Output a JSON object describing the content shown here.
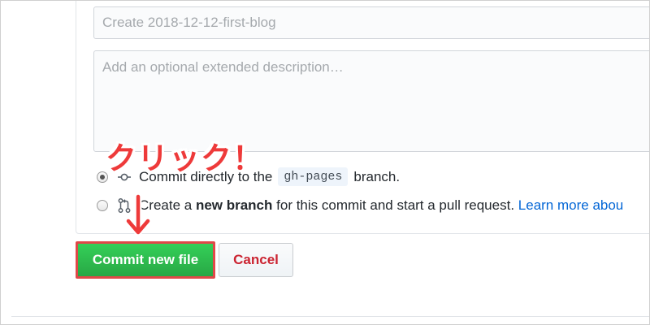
{
  "commit_form": {
    "summary_placeholder": "Create 2018-12-12-first-blog",
    "description_placeholder": "Add an optional extended description…",
    "option_direct": {
      "prefix": "Commit directly to the",
      "branch": "gh-pages",
      "suffix": "branch.",
      "selected": true
    },
    "option_new_branch": {
      "prefix": "Create a",
      "bold": "new branch",
      "middle": "for this commit and start a pull request.",
      "link": "Learn more abou",
      "selected": false
    },
    "commit_button_label": "Commit new file",
    "cancel_button_label": "Cancel"
  },
  "annotation": {
    "text": "クリック！",
    "color": "#ee3a3a"
  },
  "colors": {
    "commit_button": "#28a745",
    "cancel_text": "#cb2431",
    "link": "#0366d6",
    "highlight_border": "#e04848"
  },
  "icons": {
    "commit": "git-commit-icon",
    "pull_request": "git-pull-request-icon",
    "arrow": "arrow-down-icon"
  }
}
